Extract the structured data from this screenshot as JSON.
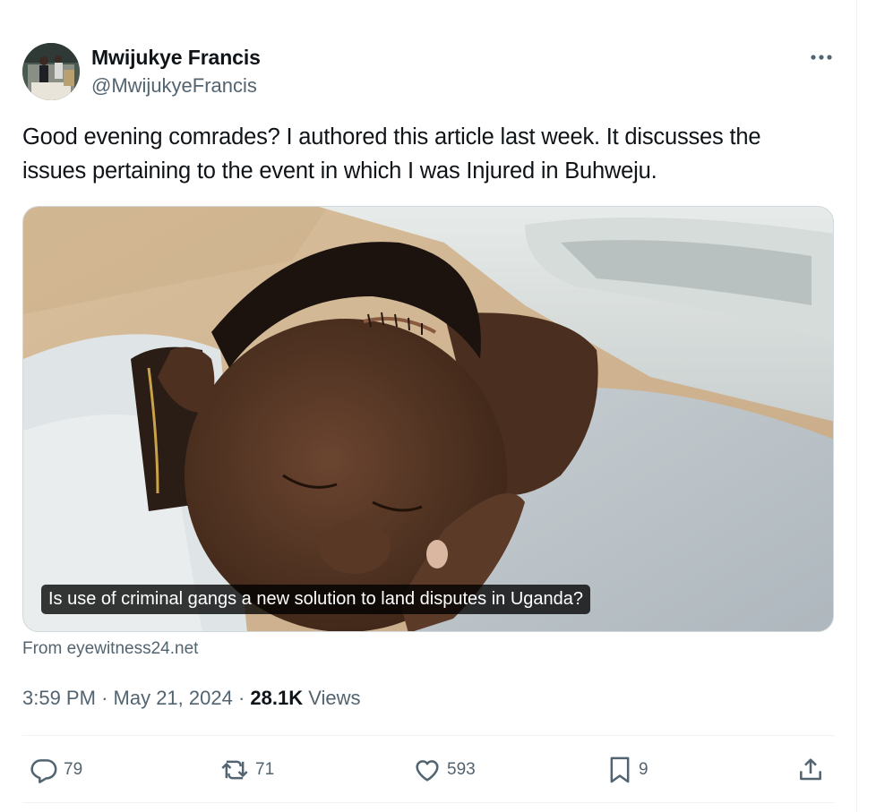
{
  "user": {
    "display_name": "Mwijukye Francis",
    "handle": "@MwijukyeFrancis"
  },
  "tweet": {
    "text": "Good evening comrades? I authored this article last week. It discusses the issues pertaining to the event in which I was Injured in Buhweju."
  },
  "media": {
    "caption": "Is use of criminal gangs a new solution to land disputes in Uganda?",
    "source": "From eyewitness24.net"
  },
  "meta": {
    "time": "3:59 PM",
    "separator": "·",
    "date": "May 21, 2024",
    "views_count": "28.1K",
    "views_label": "Views"
  },
  "actions": {
    "replies": "79",
    "reposts": "71",
    "likes": "593",
    "bookmarks": "9"
  },
  "icons": {
    "more": "more-horizontal-icon",
    "reply": "speech-bubble-icon",
    "repost": "repost-arrows-icon",
    "like": "heart-icon",
    "bookmark": "bookmark-icon",
    "share": "share-upload-icon"
  },
  "colors": {
    "text_primary": "#0f1419",
    "text_secondary": "#536471",
    "divider": "#eff3f4"
  }
}
